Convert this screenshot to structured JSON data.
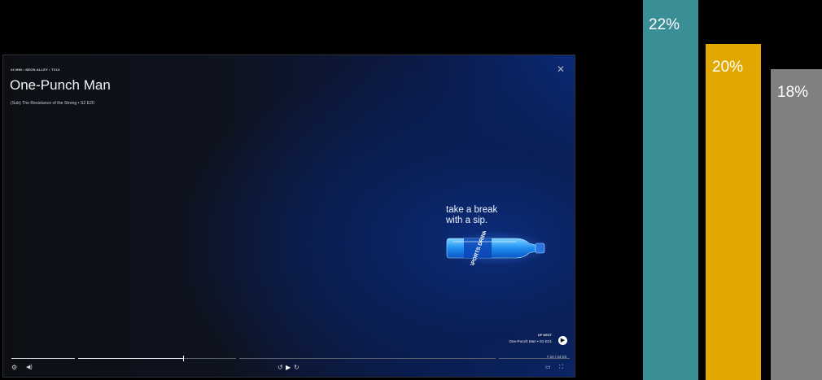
{
  "player": {
    "meta": "24 MIN • NEON ALLEY • TV14",
    "title": "One-Punch Man",
    "subtitle": "(Sub) The Resistance of the Strong • S2 E20",
    "close_icon": "close-icon",
    "ad": {
      "text_line1": "take a break",
      "text_line2": "with a sip.",
      "bottle_label": "SPORTS DRINK"
    },
    "up_next": {
      "label": "UP NEXT",
      "episode": "One-Punch Man • S2 E21"
    },
    "time": "7:24 / 24:03",
    "progress": 0.3,
    "controls": {
      "settings_icon": "gear-icon",
      "volume_icon": "volume-icon",
      "rewind_icon": "rewind-10-icon",
      "play_icon": "play-icon",
      "forward_icon": "forward-10-icon",
      "cast_icon": "cast-icon",
      "fullscreen_icon": "fullscreen-icon"
    }
  },
  "chart_data": {
    "type": "bar",
    "categories": [
      "",
      "",
      ""
    ],
    "values": [
      22,
      20,
      18
    ],
    "labels": [
      "22%",
      "20%",
      "18%"
    ],
    "colors": [
      "#3a8e96",
      "#e0a800",
      "#808080"
    ]
  }
}
